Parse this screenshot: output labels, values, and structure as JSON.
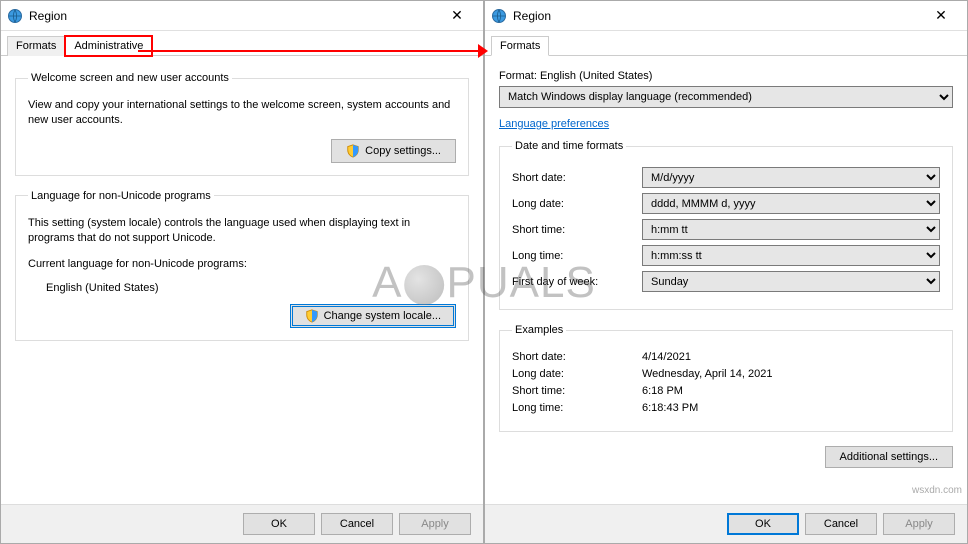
{
  "left_window": {
    "title": "Region",
    "tabs": {
      "formats": "Formats",
      "administrative": "Administrative"
    },
    "group1": {
      "legend": "Welcome screen and new user accounts",
      "desc": "View and copy your international settings to the welcome screen, system accounts and new user accounts.",
      "button": "Copy settings..."
    },
    "group2": {
      "legend": "Language for non-Unicode programs",
      "desc": "This setting (system locale) controls the language used when displaying text in programs that do not support Unicode.",
      "current_label": "Current language for non-Unicode programs:",
      "current_value": "English (United States)",
      "button": "Change system locale..."
    },
    "buttons": {
      "ok": "OK",
      "cancel": "Cancel",
      "apply": "Apply"
    }
  },
  "right_window": {
    "title": "Region",
    "tabs": {
      "formats": "Formats"
    },
    "format_label": "Format: English (United States)",
    "format_select": "Match Windows display language (recommended)",
    "lang_prefs": "Language preferences",
    "dt_group": {
      "legend": "Date and time formats",
      "rows": {
        "short_date": {
          "label": "Short date:",
          "value": "M/d/yyyy"
        },
        "long_date": {
          "label": "Long date:",
          "value": "dddd, MMMM d, yyyy"
        },
        "short_time": {
          "label": "Short time:",
          "value": "h:mm tt"
        },
        "long_time": {
          "label": "Long time:",
          "value": "h:mm:ss tt"
        },
        "first_day": {
          "label": "First day of week:",
          "value": "Sunday"
        }
      }
    },
    "examples": {
      "legend": "Examples",
      "rows": {
        "short_date": {
          "label": "Short date:",
          "value": "4/14/2021"
        },
        "long_date": {
          "label": "Long date:",
          "value": "Wednesday, April 14, 2021"
        },
        "short_time": {
          "label": "Short time:",
          "value": "6:18 PM"
        },
        "long_time": {
          "label": "Long time:",
          "value": "6:18:43 PM"
        }
      }
    },
    "additional": "Additional settings...",
    "buttons": {
      "ok": "OK",
      "cancel": "Cancel",
      "apply": "Apply"
    }
  },
  "watermark": {
    "left": "A",
    "right": "PUALS"
  },
  "wsxdn": "wsxdn.com"
}
